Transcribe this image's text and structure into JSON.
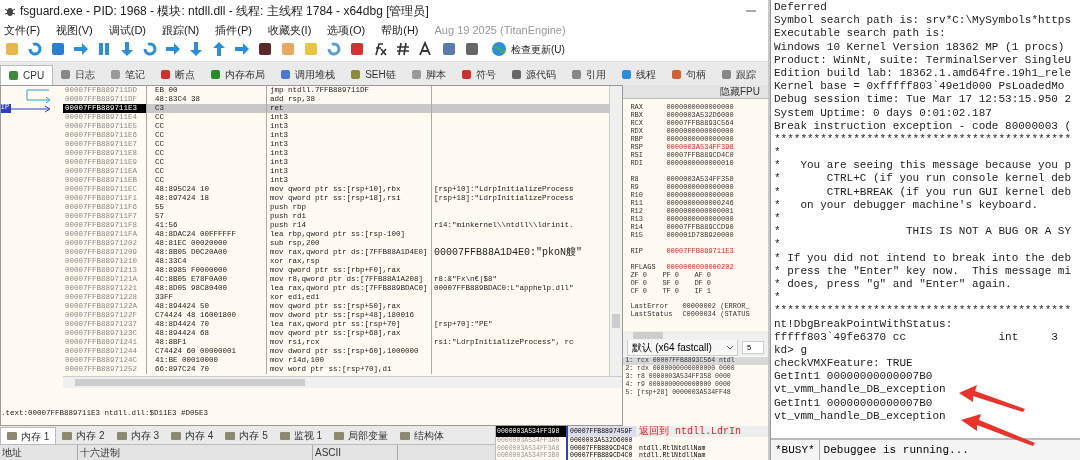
{
  "window": {
    "title": "fsguard.exe - PID: 1968 - 模块: ntdll.dll - 线程: 主线程 1784 - x64dbg [管理员]"
  },
  "menu": [
    "文件(F)",
    "视图(V)",
    "调试(D)",
    "跟踪(N)",
    "插件(P)",
    "收藏夹(I)",
    "选项(O)",
    "帮助(H)"
  ],
  "build_info": "Aug 19 2025 (TitanEngine)",
  "update_button": "检查更新(U)",
  "tabs": [
    {
      "label": "CPU",
      "selected": true
    },
    {
      "label": "日志",
      "selected": false
    },
    {
      "label": "笔记",
      "selected": false
    },
    {
      "label": "断点",
      "selected": false
    },
    {
      "label": "内存布局",
      "selected": false
    },
    {
      "label": "调用堆栈",
      "selected": false
    },
    {
      "label": "SEH链",
      "selected": false
    },
    {
      "label": "脚本",
      "selected": false
    },
    {
      "label": "符号",
      "selected": false
    },
    {
      "label": "源代码",
      "selected": false
    },
    {
      "label": "引用",
      "selected": false
    },
    {
      "label": "线程",
      "selected": false
    },
    {
      "label": "句柄",
      "selected": false
    },
    {
      "label": "跟踪",
      "selected": false
    }
  ],
  "ip_label": "IP",
  "disassembly": [
    {
      "address": "00007FFB889711DD",
      "bytes": "EB 00",
      "instruction": "jmp ntdll.7FFB889711DF",
      "selected": false
    },
    {
      "address": "00007FFB889711DF",
      "bytes": "48:83C4 38",
      "instruction": "add rsp,38",
      "selected": false
    },
    {
      "address": "00007FFB889711E3",
      "bytes": "C3",
      "instruction": "ret",
      "selected": true
    },
    {
      "address": "00007FFB889711E4",
      "bytes": "CC",
      "instruction": "int3",
      "selected": false
    },
    {
      "address": "00007FFB889711E5",
      "bytes": "CC",
      "instruction": "int3",
      "selected": false
    },
    {
      "address": "00007FFB889711E6",
      "bytes": "CC",
      "instruction": "int3",
      "selected": false
    },
    {
      "address": "00007FFB889711E7",
      "bytes": "CC",
      "instruction": "int3",
      "selected": false
    },
    {
      "address": "00007FFB889711E8",
      "bytes": "CC",
      "instruction": "int3",
      "selected": false
    },
    {
      "address": "00007FFB889711E9",
      "bytes": "CC",
      "instruction": "int3",
      "selected": false
    },
    {
      "address": "00007FFB889711EA",
      "bytes": "CC",
      "instruction": "int3",
      "selected": false
    },
    {
      "address": "00007FFB889711EB",
      "bytes": "CC",
      "instruction": "int3",
      "selected": false
    },
    {
      "address": "00007FFB889711EC",
      "bytes": "48:895C24 10",
      "instruction": "mov qword ptr ss:[rsp+10],rbx",
      "comment": "[rsp+10]:\"LdrpInitializeProcess",
      "selected": false
    },
    {
      "address": "00007FFB889711F1",
      "bytes": "48:897424 18",
      "instruction": "mov qword ptr ss:[rsp+18],rsi",
      "comment": "[rsp+18]:\"LdrpInitializeProcess",
      "selected": false
    },
    {
      "address": "00007FFB889711F6",
      "bytes": "55",
      "instruction": "push rbp",
      "selected": false
    },
    {
      "address": "00007FFB889711F7",
      "bytes": "57",
      "instruction": "push rdi",
      "selected": false
    },
    {
      "address": "00007FFB889711F8",
      "bytes": "41:56",
      "instruction": "push r14",
      "comment": "r14:\"minkernel\\\\ntdll\\\\ldrinit.",
      "selected": false
    },
    {
      "address": "00007FFB889711FA",
      "bytes": "48:8DAC24 00FFFFFF",
      "instruction": "lea rbp,qword ptr ss:[rsp-100]",
      "selected": false
    },
    {
      "address": "00007FFB88971202",
      "bytes": "48:81EC 00020000",
      "instruction": "sub rsp,200",
      "selected": false
    },
    {
      "address": "00007FFB88971209",
      "bytes": "48:8B05 D0C20A00",
      "instruction": "mov rax,qword ptr ds:[7FFB88A1D4E0]",
      "comment": "00007FFB88A1D4E0:\"pkoN艘\"",
      "selected": false
    },
    {
      "address": "00007FFB88971210",
      "bytes": "48:33C4",
      "instruction": "xor rax,rsp",
      "selected": false
    },
    {
      "address": "00007FFB88971213",
      "bytes": "48:8985 F0000000",
      "instruction": "mov qword ptr ss:[rbp+F0],rax",
      "selected": false
    },
    {
      "address": "00007FFB8897121A",
      "bytes": "4C:8B05 E78F0A00",
      "instruction": "mov r8,qword ptr ds:[7FFB88A1A208]",
      "comment": "r8:&\"Fx\\n€|$8\"",
      "selected": false
    },
    {
      "address": "00007FFB88971221",
      "bytes": "48:8D05 98C80400",
      "instruction": "lea rax,qword ptr ds:[7FFB889BDAC0]",
      "comment": "00007FFB889BDAC0:L\"apphelp.dll\"",
      "selected": false
    },
    {
      "address": "00007FFB88971228",
      "bytes": "33FF",
      "instruction": "xor edi,edi",
      "selected": false
    },
    {
      "address": "00007FFB8897122A",
      "bytes": "48:894424 50",
      "instruction": "mov qword ptr ss:[rsp+50],rax",
      "selected": false
    },
    {
      "address": "00007FFB8897122F",
      "bytes": "C74424 48 16001800",
      "instruction": "mov dword ptr ss:[rsp+48],180016",
      "selected": false
    },
    {
      "address": "00007FFB88971237",
      "bytes": "48:8D4424 70",
      "instruction": "lea rax,qword ptr ss:[rsp+70]",
      "comment": "[rsp+70]:\"PE\"",
      "selected": false
    },
    {
      "address": "00007FFB8897123C",
      "bytes": "48:894424 68",
      "instruction": "mov qword ptr ss:[rsp+68],rax",
      "selected": false
    },
    {
      "address": "00007FFB88971241",
      "bytes": "48:8BF1",
      "instruction": "mov rsi,rcx",
      "comment": "rsi:\"LdrpInitializeProcess\", rc",
      "selected": false
    },
    {
      "address": "00007FFB88971244",
      "bytes": "C74424 60 00000001",
      "instruction": "mov dword ptr ss:[rsp+60],1000000",
      "selected": false
    },
    {
      "address": "00007FFB8897124C",
      "bytes": "41:BE 00010000",
      "instruction": "mov r14d,100",
      "selected": false
    },
    {
      "address": "00007FFB88971252",
      "bytes": "66:897C24 70",
      "instruction": "mov word ptr ss:[rsp+70],di",
      "selected": false
    }
  ],
  "location_info": ".text:00007FFB889711E3 ntdll.dll:$D11E3 #D05E3",
  "registers_panel": {
    "header": "隐藏FPU",
    "groups": [
      [
        {
          "name": "RAX",
          "value": "0000000000000000",
          "changed": false
        },
        {
          "name": "RBX",
          "value": "0000003A532D6000",
          "changed": false
        },
        {
          "name": "RCX",
          "value": "00007FFB8893C564",
          "changed": false
        },
        {
          "name": "RDX",
          "value": "0000000000000000",
          "changed": false
        },
        {
          "name": "RBP",
          "value": "0000000000000000",
          "changed": false
        },
        {
          "name": "RSP",
          "value": "0000003A534FF398",
          "changed": true
        },
        {
          "name": "RSI",
          "value": "00007FFB889CD4C0",
          "changed": false
        },
        {
          "name": "RDI",
          "value": "0000000000000010",
          "changed": false
        }
      ],
      [
        {
          "name": "R8",
          "value": "0000003A534FF358",
          "changed": false
        },
        {
          "name": "R9",
          "value": "0000000000000000",
          "changed": false
        },
        {
          "name": "R10",
          "value": "0000000000000000",
          "changed": false
        },
        {
          "name": "R11",
          "value": "0000000000000246",
          "changed": false
        },
        {
          "name": "R12",
          "value": "0000000000000001",
          "changed": false
        },
        {
          "name": "R13",
          "value": "0000000000000000",
          "changed": false
        },
        {
          "name": "R14",
          "value": "00007FFB889CCD90",
          "changed": false
        },
        {
          "name": "R15",
          "value": "000001D78B920000",
          "changed": false
        }
      ],
      [
        {
          "name": "RIP",
          "value": "00007FFB889711E3",
          "changed": true
        }
      ]
    ],
    "rflags": {
      "name": "RFLAGS",
      "value": "0000000000000202",
      "changed": true
    },
    "flags": [
      [
        {
          "name": "ZF",
          "value": "0"
        },
        {
          "name": "PF",
          "value": "0"
        },
        {
          "name": "AF",
          "value": "0"
        }
      ],
      [
        {
          "name": "OF",
          "value": "0"
        },
        {
          "name": "SF",
          "value": "0"
        },
        {
          "name": "DF",
          "value": "0"
        }
      ],
      [
        {
          "name": "CF",
          "value": "0"
        },
        {
          "name": "TF",
          "value": "0"
        },
        {
          "name": "IF",
          "value": "1"
        }
      ]
    ],
    "last": [
      {
        "name": "LastError",
        "value": "00000002 (ERROR_"
      },
      {
        "name": "LastStatus",
        "value": "C0000034 (STATUS"
      }
    ]
  },
  "call_convention": {
    "value": "默认 (x64 fastcall)",
    "count": "5",
    "args": [
      "1: rcx 00007FFB8893C564 ntdl",
      "2: rdx 0000000000000000 0000",
      "3: r8 0000003A534FF358 0000",
      "4: r9 0000000000000000 0000",
      "5: [rsp+28] 0000003A534FF48"
    ]
  },
  "memory_tabs": [
    {
      "label": "内存 1",
      "selected": true
    },
    {
      "label": "内存 2",
      "selected": false
    },
    {
      "label": "内存 3",
      "selected": false
    },
    {
      "label": "内存 4",
      "selected": false
    },
    {
      "label": "内存 5",
      "selected": false
    },
    {
      "label": "监视 1",
      "selected": false
    },
    {
      "label": "局部变量",
      "selected": false
    },
    {
      "label": "结构体",
      "selected": false
    }
  ],
  "dump_columns": [
    "地址",
    "十六进制",
    "ASCII"
  ],
  "stack": [
    {
      "address": "0000003A534FF398",
      "value": "00007FFB8897459F",
      "comment": "返回到 ntdll.LdrIn",
      "selected": true
    },
    {
      "address": "0000003A534FF3A0",
      "value": "0000003A532D6000",
      "selected": false
    },
    {
      "address": "0000003A534FF3A8",
      "value": "00007FFB889CD4C0",
      "comment": "ntdll.RtlNtdllNam",
      "selected": false
    },
    {
      "address": "0000003A534FF3B0",
      "value": "00007FFB889CD4C0",
      "comment": "ntdll.RtlNtdllNam",
      "selected": false
    }
  ],
  "kernel_debugger": {
    "lines": [
      "Deferred",
      "Symbol search path is: srv*C:\\MySymbols*https",
      "Executable search path is:",
      "Windows 10 Kernel Version 18362 MP (1 procs)",
      "Product: WinNt, suite: TerminalServer SingleU",
      "Edition build lab: 18362.1.amd64fre.19h1_rele",
      "Kernel base = 0xfffff803`49e1d000 PsLoadedMo",
      "Debug session time: Tue Mar 17 12:53:15.950 2",
      "System Uptime: 0 days 0:01:02.187",
      "Break instruction exception - code 80000003 (",
      "*********************************************",
      "*",
      "*   You are seeing this message because you p",
      "*       CTRL+C (if you run console kernel deb",
      "*       CTRL+BREAK (if you run GUI kernel deb",
      "*   on your debugger machine's keyboard.",
      "*",
      "*                   THIS IS NOT A BUG OR A SY",
      "*",
      "* If you did not intend to break into the deb",
      "* press the \"Enter\" key now.  This message mi",
      "* does, press \"g\" and \"Enter\" again.",
      "*",
      "*********************************************",
      "nt!DbgBreakPointWithStatus:",
      "fffff803`49fe6370 cc              int     3",
      "kd> g",
      "checkVMXFeature: TRUE",
      "GetInt1 00000000000007B0",
      "vt_vmm_handle_DB_exception",
      "GetInt1 00000000000007B0",
      "vt_vmm_handle_DB_exception"
    ],
    "status_busy": "*BUSY*",
    "status_text": "Debuggee is running..."
  }
}
